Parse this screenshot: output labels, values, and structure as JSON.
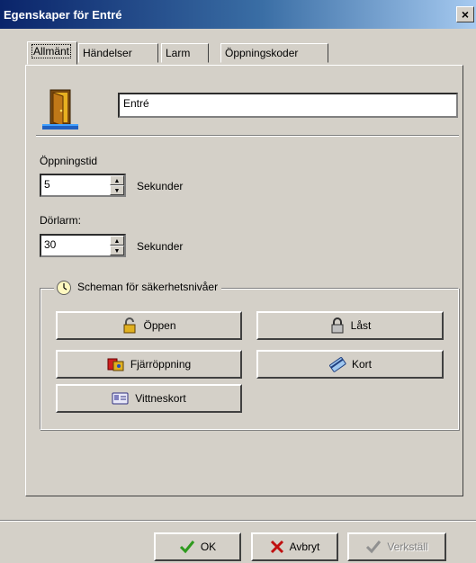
{
  "window": {
    "title": "Egenskaper för Entré",
    "close_glyph": "×"
  },
  "tabs": [
    {
      "label": "Allmänt",
      "active": true
    },
    {
      "label": "Händelser",
      "active": false
    },
    {
      "label": "Larm",
      "active": false
    },
    {
      "label": "Öppningskoder",
      "active": false
    }
  ],
  "general": {
    "icon": "door-icon",
    "name_value": "Entré",
    "opening_time": {
      "label": "Öppningstid",
      "value": "5",
      "unit": "Sekunder"
    },
    "door_alarm": {
      "label": "Dörlarm:",
      "value": "30",
      "unit": "Sekunder"
    }
  },
  "schedules": {
    "legend": "Scheman för säkerhetsnivåer",
    "icon": "clock-icon",
    "buttons": {
      "open": {
        "label": "Öppen",
        "icon": "padlock-open-icon"
      },
      "locked": {
        "label": "Låst",
        "icon": "padlock-locked-icon"
      },
      "remote": {
        "label": "Fjärröppning",
        "icon": "remote-open-icon"
      },
      "card": {
        "label": "Kort",
        "icon": "card-icon"
      },
      "witness": {
        "label": "Vittneskort",
        "icon": "witness-card-icon"
      }
    }
  },
  "footer": {
    "ok": {
      "label": "OK",
      "icon": "check-icon",
      "icon_color": "#2e9a1e"
    },
    "cancel": {
      "label": "Avbryt",
      "icon": "x-icon",
      "icon_color": "#c01010"
    },
    "apply": {
      "label": "Verkställ",
      "icon": "check-icon",
      "enabled": false
    }
  },
  "colors": {
    "titlebar_start": "#0a246a",
    "titlebar_end": "#a6caf0",
    "face": "#d4d0c8"
  }
}
